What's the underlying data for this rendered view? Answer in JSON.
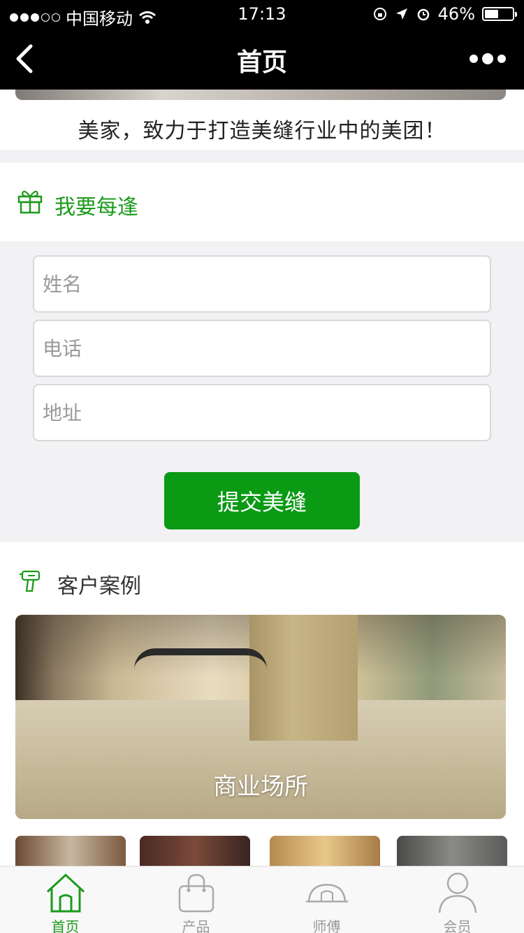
{
  "status_bar": {
    "carrier": "中国移动",
    "time": "17:13",
    "battery": "46%"
  },
  "nav": {
    "title": "首页"
  },
  "slogan": "美家，致力于打造美缝行业中的美团！",
  "appointment": {
    "title": "我要每逢",
    "fields": {
      "name_placeholder": "姓名",
      "phone_placeholder": "电话",
      "address_placeholder": "地址"
    },
    "submit_label": "提交美缝"
  },
  "cases": {
    "title": "客户案例",
    "featured_label": "商业场所"
  },
  "tabbar": {
    "items": [
      {
        "label": "首页",
        "icon": "home-icon",
        "active": true
      },
      {
        "label": "产品",
        "icon": "bag-icon",
        "active": false
      },
      {
        "label": "师傅",
        "icon": "helmet-icon",
        "active": false
      },
      {
        "label": "会员",
        "icon": "user-icon",
        "active": false
      }
    ]
  },
  "colors": {
    "accent": "#1c9a1c",
    "button": "#0a9a14"
  }
}
